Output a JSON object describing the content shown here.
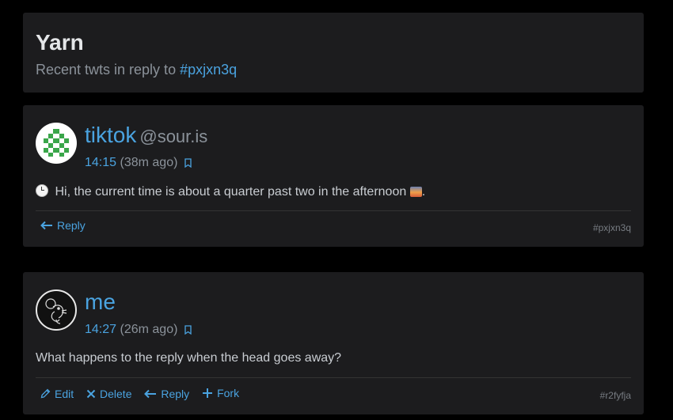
{
  "header": {
    "title": "Yarn",
    "subtitle_prefix": "Recent twts in reply to ",
    "subtitle_hash": "#pxjxn3q"
  },
  "twts": [
    {
      "nick": "tiktok",
      "handle": "@sour.is",
      "time": "14:15",
      "ago": "(38m ago)",
      "content": "Hi, the current time is about a quarter past two in the afternoon",
      "content_suffix": ".",
      "actions": {
        "reply": "Reply"
      },
      "hash": "#pxjxn3q",
      "icons": [
        "bookmark-icon",
        "clock-emoji-icon",
        "sunset-emoji-icon",
        "arrow-left-icon"
      ]
    },
    {
      "nick": "me",
      "time": "14:27",
      "ago": "(26m ago)",
      "content": "What happens to the reply when the head goes away?",
      "actions": {
        "edit": "Edit",
        "delete": "Delete",
        "reply": "Reply",
        "fork": "Fork"
      },
      "hash": "#r2fyfja",
      "icons": [
        "pencil-icon",
        "close-icon",
        "arrow-left-icon",
        "plus-icon"
      ]
    }
  ],
  "colors": {
    "accent": "#4aa3e0",
    "card": "#1c1c1e",
    "background": "#000000",
    "muted": "#8b929a"
  }
}
